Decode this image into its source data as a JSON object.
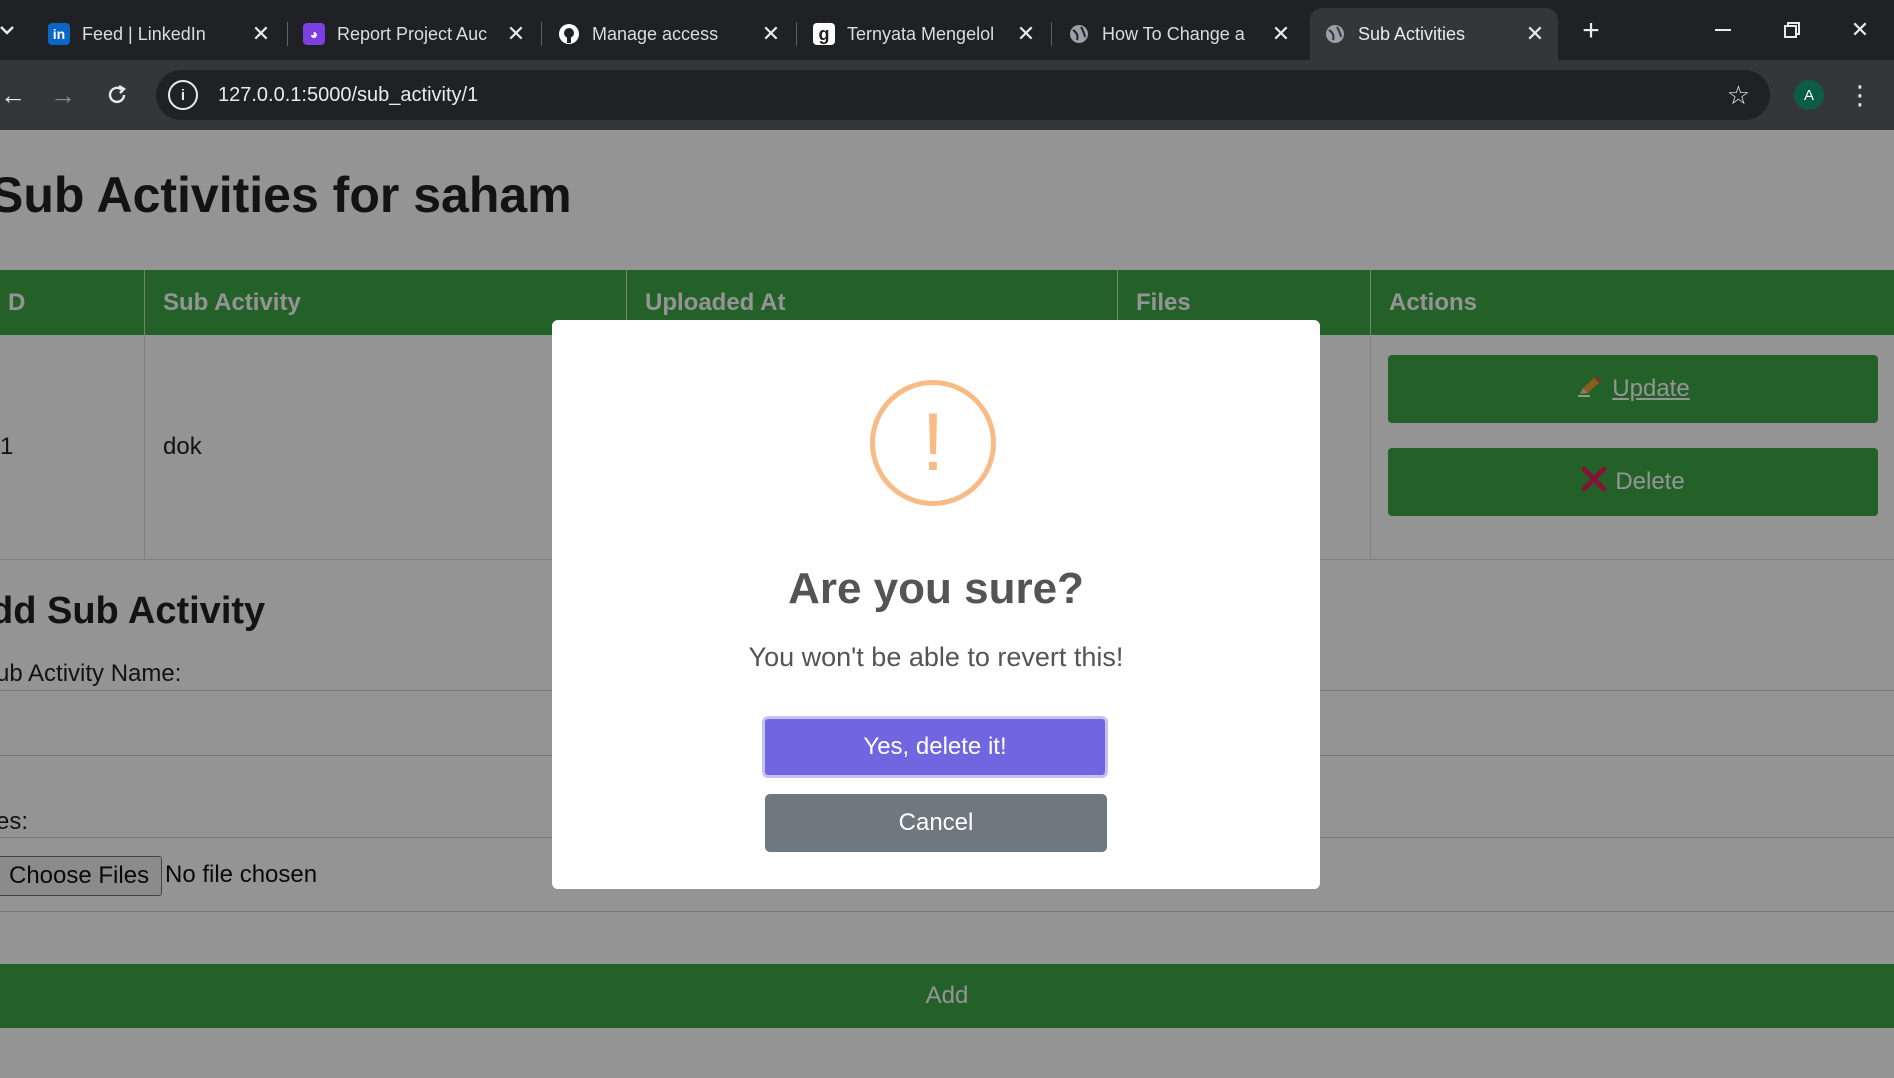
{
  "browser": {
    "tabs": [
      {
        "title": "Feed | LinkedIn",
        "icon": "linkedin-icon"
      },
      {
        "title": "Report Project Auc",
        "icon": "report-app-icon"
      },
      {
        "title": "Manage access",
        "icon": "github-icon"
      },
      {
        "title": "Ternyata Mengelol",
        "icon": "g-icon"
      },
      {
        "title": "How To Change a",
        "icon": "globe-icon"
      },
      {
        "title": "Sub Activities",
        "icon": "globe-icon",
        "active": true
      }
    ],
    "url": "127.0.0.1:5000/sub_activity/1",
    "profile_initial": "A"
  },
  "page": {
    "title": "Sub Activities for saham",
    "table": {
      "headers": [
        "D",
        "Sub Activity",
        "Uploaded At",
        "Files",
        "Actions"
      ],
      "rows": [
        {
          "id": "1",
          "sub_activity": "dok",
          "uploaded_at": "",
          "files": ""
        }
      ],
      "update_label": "Update",
      "delete_label": "Delete"
    },
    "add_section": {
      "title": "dd Sub Activity",
      "name_label": "ub Activity Name:",
      "files_label": "es:",
      "choose_files_label": "Choose Files",
      "no_file_text": "No file chosen",
      "add_label": "Add"
    }
  },
  "modal": {
    "icon_symbol": "!",
    "title": "Are you sure?",
    "text": "You won't be able to revert this!",
    "confirm_label": "Yes, delete it!",
    "cancel_label": "Cancel"
  },
  "colors": {
    "header_green": "#3da847",
    "confirm_purple": "#7066e0",
    "cancel_gray": "#6e7881",
    "warning_orange": "#f8bb86"
  }
}
